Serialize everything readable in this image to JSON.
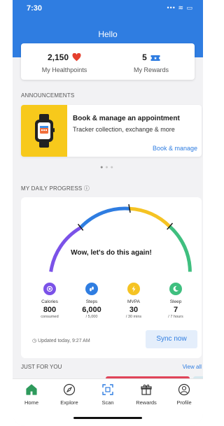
{
  "status_bar": {
    "time": "7:30",
    "icons": "••• ≋ ▭"
  },
  "header": {
    "title": "Hello"
  },
  "stats": {
    "healthpoints": {
      "value": "2,150",
      "label": "My Healthpoints",
      "icon": "heart-icon"
    },
    "rewards": {
      "value": "5",
      "label": "My Rewards",
      "icon": "ticket-icon"
    }
  },
  "announcements": {
    "section_label": "ANNOUNCEMENTS",
    "card": {
      "title": "Book & manage an appointment",
      "subtitle": "Tracker collection, exchange & more",
      "link": "Book & manage",
      "icon": "smartwatch-icon"
    },
    "pager": {
      "count": 3,
      "active": 0
    }
  },
  "progress": {
    "section_label": "MY DAILY PROGRESS",
    "message": "Wow, let's do this again!",
    "metrics": [
      {
        "name": "Calories",
        "value": "800",
        "sub": "consumed",
        "color": "#7b52e8",
        "icon": "plate-icon"
      },
      {
        "name": "Steps",
        "value": "6,000",
        "sub": "/ 5,000",
        "color": "#2f7de1",
        "icon": "footsteps-icon"
      },
      {
        "name": "MVPA",
        "value": "30",
        "sub": "/ 30 mins",
        "color": "#f5c323",
        "icon": "lightning-icon"
      },
      {
        "name": "Sleep",
        "value": "7",
        "sub": "/ 7 hours",
        "color": "#3fbf7f",
        "icon": "moon-icon"
      }
    ],
    "updated": "Updated today, 9:27 AM",
    "sync_label": "Sync now"
  },
  "just_for_you": {
    "label": "JUST FOR YOU",
    "view_all": "View all"
  },
  "nav": [
    {
      "label": "Home",
      "icon": "home-icon",
      "active": true
    },
    {
      "label": "Explore",
      "icon": "compass-icon",
      "active": false
    },
    {
      "label": "Scan",
      "icon": "scan-icon",
      "active": false
    },
    {
      "label": "Rewards",
      "icon": "gift-icon",
      "active": false
    },
    {
      "label": "Profile",
      "icon": "profile-icon",
      "active": false
    }
  ],
  "colors": {
    "brand_blue": "#2f7de1",
    "heart_red": "#e5402e",
    "announcement_yellow": "#f7c91b",
    "home_green": "#2e9a5c"
  }
}
